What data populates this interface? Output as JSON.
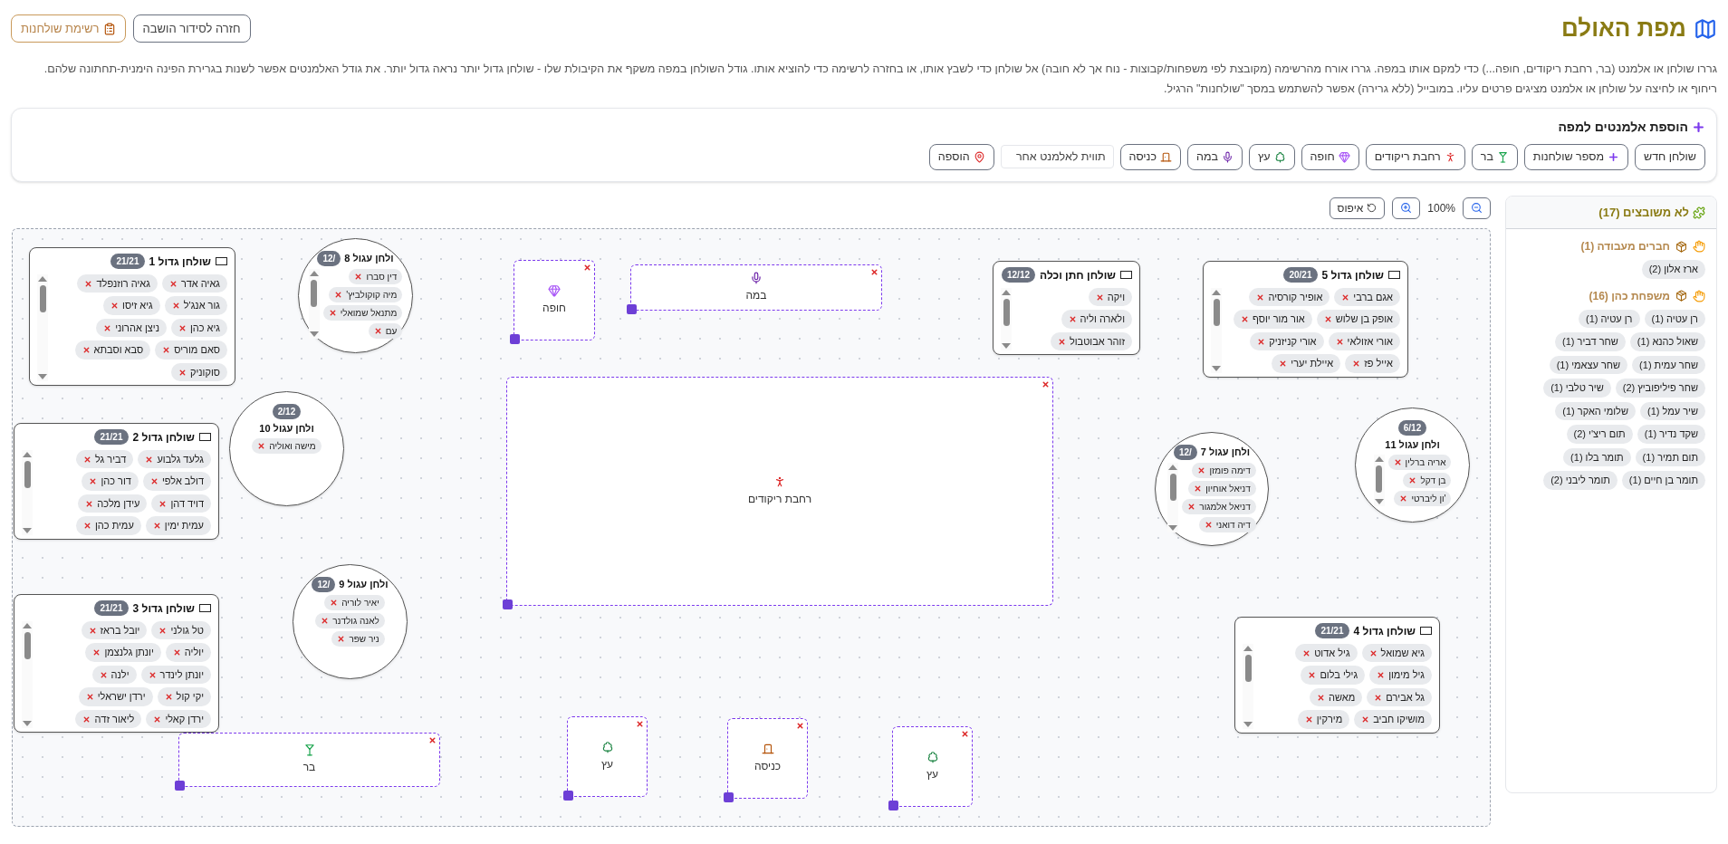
{
  "header": {
    "title": "מפת האולם",
    "buttons": [
      {
        "label": "חזרה לסידור הושבה",
        "kind": "back"
      },
      {
        "label": "רשימת שולחנות",
        "kind": "list"
      }
    ]
  },
  "description": "גררו שולחן או אלמנט (בר, רחבת ריקודים, חופה...) כדי למקם אותו במפה. גררו אורח מהרשימה (מקובצת לפי משפחות/קבוצות - נוח אך לא חובה) אל שולחן כדי לשבץ אותו, או בחזרה לרשימה כדי להוציא אותו. גודל השולחן במפה משקף את הקיבולת שלו - שולחן גדול יותר נראה גדול יותר. את גודל האלמנטים אפשר לשנות בגרירת הפינה הימנית-תחתונה שלהם. ריחוף או לחיצה על שולחן או אלמנט מציגים פרטים עליו. במובייל (ללא גרירה) אפשר להשתמש במסך \"שולחנות\" הרגיל.",
  "add_panel": {
    "title": "הוספת אלמנטים למפה",
    "buttons": [
      {
        "label": "שולחן חדש",
        "kind": "table"
      },
      {
        "label": "מספר שולחנות",
        "kind": "multi"
      },
      {
        "label": "בר",
        "kind": "bar"
      },
      {
        "label": "רחבת ריקודים",
        "kind": "dancefloor"
      },
      {
        "label": "חופה",
        "kind": "chuppah"
      },
      {
        "label": "עץ",
        "kind": "tree"
      },
      {
        "label": "במה",
        "kind": "stage"
      },
      {
        "label": "כניסה",
        "kind": "entrance"
      }
    ],
    "label_field": {
      "placeholder": "תווית לאלמנט אחר"
    },
    "add_button": {
      "label": "הוספה"
    }
  },
  "zoom": {
    "level_text": "100%",
    "reset_label": "איפוס"
  },
  "canvas": {
    "tables": [
      {
        "name": "שולחן גדול 5",
        "count": "20/21",
        "kind": "rect",
        "guests": [
          "אגם ברבי",
          "אופיר קורסיה",
          "אופק בן שלוש",
          "אור מור יוסף",
          "אורי אזולאי",
          "אורי קניזניק",
          "אייל פז",
          "איילת יערי"
        ]
      },
      {
        "name": "שולחן חתן וכלה",
        "count": "12/12",
        "kind": "rect",
        "guests": [
          "ויקה",
          "ולארה וליה",
          "זוהר אבוטבול"
        ]
      },
      {
        "name": "ולחן עגול 8",
        "count": "/12",
        "kind": "round",
        "guests": [
          "דין סברו",
          "מיה קוקולביץ'",
          "מתנאל שמואלי",
          "עם"
        ]
      },
      {
        "name": "שולחן גדול 1",
        "count": "21/21",
        "kind": "rect",
        "guests": [
          "גאיה אדר",
          "גאיה רוזנפלד",
          "גור אנג'ל",
          "גיא זיסו",
          "גיא כהן",
          "ניצן אהרוני",
          "סאם מוריס",
          "סבא וסבתא",
          "סוקוניק"
        ]
      },
      {
        "name": "ולחן עגול 11",
        "count": "6/12",
        "kind": "round",
        "guests": [
          "אריה ברלין",
          "בן דקל",
          "'ון ליברטי"
        ]
      },
      {
        "name": "ולחן עגול 7",
        "count": "/12",
        "kind": "round",
        "guests": [
          "דימה פומזן",
          "דניאל אוחיון",
          "דניאל אלמגור",
          "דיה דואני"
        ]
      },
      {
        "name": "ולחן עגול 10",
        "count": "2/12",
        "kind": "round",
        "guests": [
          "מישה ואוליה"
        ]
      },
      {
        "name": "שולחן גדול 2",
        "count": "21/21",
        "kind": "rect",
        "guests": [
          "גלעד גלבוע",
          "דביר גל",
          "דולב אלפי",
          "דור כהן",
          "דויד דהן",
          "עידן מלכה",
          "עמית ימין",
          "עמית כהן"
        ]
      },
      {
        "name": "שולחן גדול 4",
        "count": "21/21",
        "kind": "rect",
        "guests": [
          "גיא שמואל",
          "גיל אדוט",
          "גיל מימון",
          "גילי בלום",
          "גל אבירם",
          "מאשה",
          "מושיקו חביב",
          "מירקין"
        ]
      },
      {
        "name": "ולחן עגול 9",
        "count": "/12",
        "kind": "round",
        "guests": [
          "יאיר לוריה",
          "לאנה גולדנר",
          "ניר שפר"
        ]
      },
      {
        "name": "שולחן גדול 3",
        "count": "21/21",
        "kind": "rect",
        "guests": [
          "טל גולני",
          "יובל בראז",
          "יוליה",
          "יונתן גלנצמן",
          "יונתן לינדר",
          "ילנה",
          "יקי קול",
          "ירדן ישראלי",
          "ירדן קאלי",
          "ליאור זדה"
        ]
      }
    ],
    "elements": [
      {
        "label": "במה",
        "kind": "stage"
      },
      {
        "label": "חופה",
        "kind": "chuppah"
      },
      {
        "label": "רחבת ריקודים",
        "kind": "dancefloor"
      },
      {
        "label": "עץ",
        "kind": "tree"
      },
      {
        "label": "כניסה",
        "kind": "entrance"
      },
      {
        "label": "עץ",
        "kind": "tree"
      },
      {
        "label": "בר",
        "kind": "bar"
      }
    ]
  },
  "unassigned": {
    "title": "לא משובצים (17)",
    "groups": [
      {
        "title": "חברים מעבודה (1)",
        "guests": [
          "ארז אלון (2)"
        ]
      },
      {
        "title": "משפחת כהן (16)",
        "guests": [
          "רן עטיה (1)",
          "רן עטיה (1)",
          "שאול כהנא (1)",
          "שחר דביר (1)",
          "שחר עמית (1)",
          "שחר עצאמי (1)",
          "שחר פיליפוביץ (2)",
          "שיר טלבי (1)",
          "שיר עמל (1)",
          "שלומי האקר (1)",
          "שקד נדיר (1)",
          "תום ריצ'י (2)",
          "תום תמיר (1)",
          "תומר בלו (1)",
          "תומר בן חיים (1)",
          "תומר ליבני (2)"
        ]
      }
    ]
  }
}
